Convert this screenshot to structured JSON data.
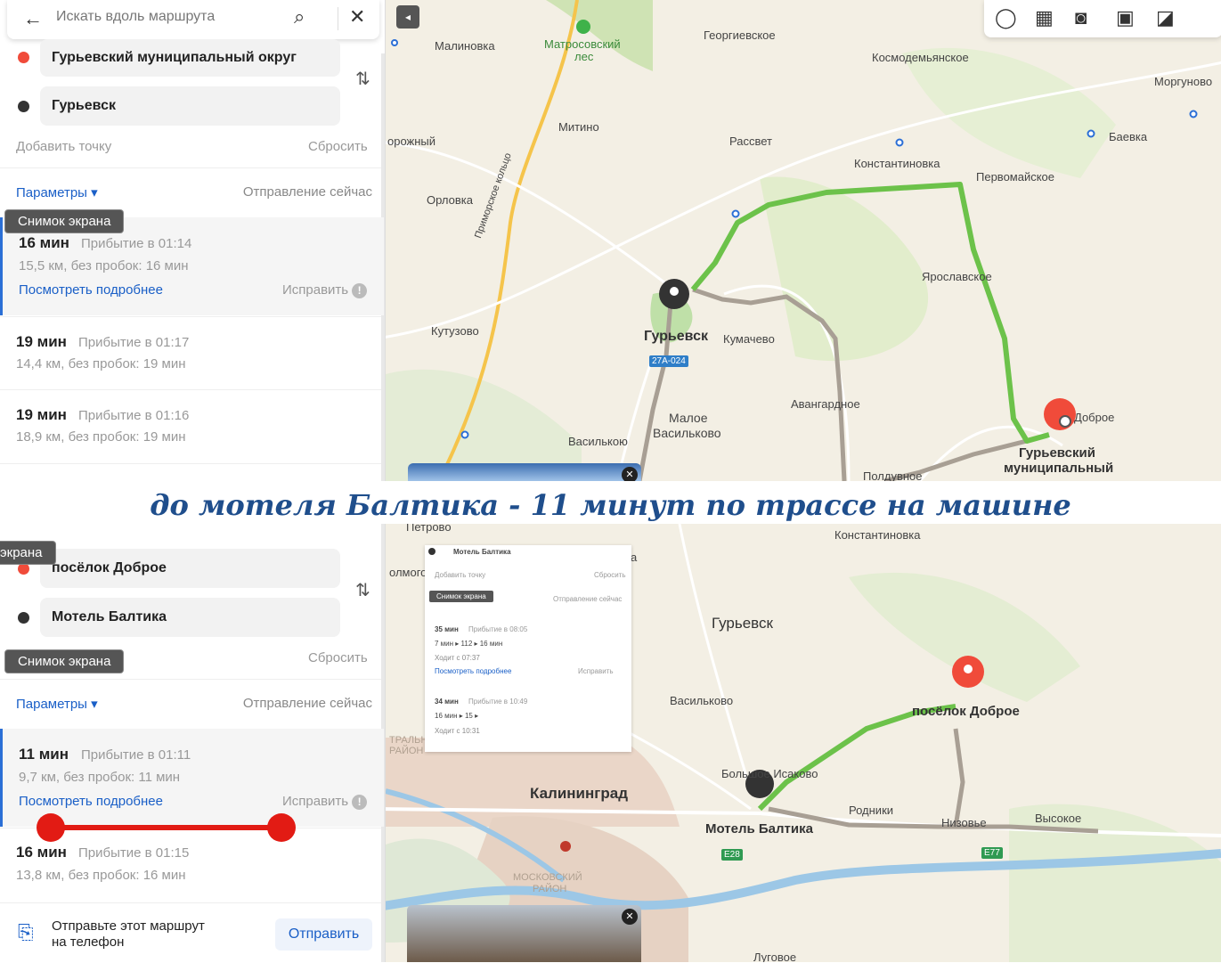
{
  "top": {
    "search_placeholder": "Искать вдоль маршрута",
    "point_a": "Гурьевский муниципальный округ",
    "point_b": "Гурьевск",
    "add_point": "Добавить точку",
    "reset": "Сбросить",
    "params": "Параметры ▾",
    "departure": "Отправление сейчас",
    "tooltip": "Снимок экрана",
    "routes": [
      {
        "time": "16 мин",
        "arrival": "Прибытие в 01:14",
        "dist": "15,5 км, без пробок: 16 мин",
        "more": "Посмотреть подробнее",
        "fix": "Исправить"
      },
      {
        "time": "19 мин",
        "arrival": "Прибытие в 01:17",
        "dist": "14,4 км, без пробок: 19 мин"
      },
      {
        "time": "19 мин",
        "arrival": "Прибытие в 01:16",
        "dist": "18,9 км, без пробок: 19 мин"
      }
    ],
    "map_labels": {
      "malinovka": "Малиновка",
      "matrosovsky": "Матросовский",
      "les": "лес",
      "georgievskoe": "Георгиевское",
      "kosmodemyanskoe": "Космодемьянское",
      "morgunovo": "Моргуново",
      "baevka": "Баевка",
      "mitino": "Митино",
      "rassvet": "Рассвет",
      "konstantinovka": "Константиновка",
      "pervomayskoe": "Первомайское",
      "dorozhny": "орожный",
      "orlovka": "Орловка",
      "primorskoe": "Приморское кольцо",
      "yaroslavskoe": "Ярославское",
      "kutuzovo": "Кутузово",
      "guryevsk": "Гурьевск",
      "kumachevo": "Кумачево",
      "shield": "27А-024",
      "avangardnoe": "Авангардное",
      "maloe": "Малое",
      "vasilkovo_m": "Васильково",
      "vasilkovo": "Василькою",
      "dobroe": "Доброе",
      "dest_line1": "Гурьевский",
      "dest_line2": "муниципальный",
      "polduvnoe": "Полдувное"
    }
  },
  "caption": "до мотеля Балтика - 11 минут по трассе на машине",
  "bottom": {
    "tooltip_left": "экрана",
    "tooltip": "Снимок экрана",
    "point_a": "посёлок Доброе",
    "point_b": "Мотель Балтика",
    "reset": "Сбросить",
    "params": "Параметры ▾",
    "departure": "Отправление сейчас",
    "routes": [
      {
        "time": "11 мин",
        "arrival": "Прибытие в 01:11",
        "dist": "9,7 км, без пробок: 11 мин",
        "more": "Посмотреть подробнее",
        "fix": "Исправить"
      },
      {
        "time": "16 мин",
        "arrival": "Прибытие в 01:15",
        "dist": "13,8 км, без пробок: 16 мин"
      }
    ],
    "send_text_1": "Отправьте этот маршрут",
    "send_text_2": "на телефон",
    "send_button": "Отправить",
    "map_labels": {
      "konstantinovka": "Константиновка",
      "guryevsk": "Гурьевск",
      "vasilkovo": "Васильково",
      "dobroe": "посёлок Доброе",
      "bolshoe": "Большое Исаково",
      "kaliningrad": "Калининград",
      "motel": "Мотель Балтика",
      "rodniki": "Родники",
      "nizovye": "Низовье",
      "vysokoe": "Высокое",
      "e28": "E28",
      "e77": "E77",
      "moskovsky": "МОСКОВСКИЙ",
      "rayon": "РАЙОН",
      "lugovoe": "Луговое",
      "petrovo": "Петрово",
      "tralny": "ТРАЛЬН",
      "rayon2": "РАЙОН",
      "olmogor": "олмогор",
      "a": "а"
    },
    "mini": {
      "dest": "Мотель Балтика",
      "add": "Добавить точку",
      "reset": "Сбросить",
      "tooltip": "Снимок экрана",
      "depart": "Отправление сейчас",
      "r1_time": "35 мин",
      "r1_arr": "Прибытие в 08:05",
      "r1_steps": "7 мин ▸ 112 ▸ 16 мин",
      "r1_runs": "Ходит с 07:37",
      "r1_more": "Посмотреть подробнее",
      "r1_fix": "Исправить",
      "r2_time": "34 мин",
      "r2_arr": "Прибытие в 10:49",
      "r2_steps": "16 мин ▸ 15 ▸",
      "r2_runs": "Ходит с 10:31"
    }
  },
  "colors": {
    "route_green": "#6cc24a",
    "route_grey": "#a89f94",
    "accent_blue": "#1a5fc7",
    "pin_red": "#f04b3a",
    "annotation_red": "#e21b14",
    "caption": "#1f4e8c"
  }
}
